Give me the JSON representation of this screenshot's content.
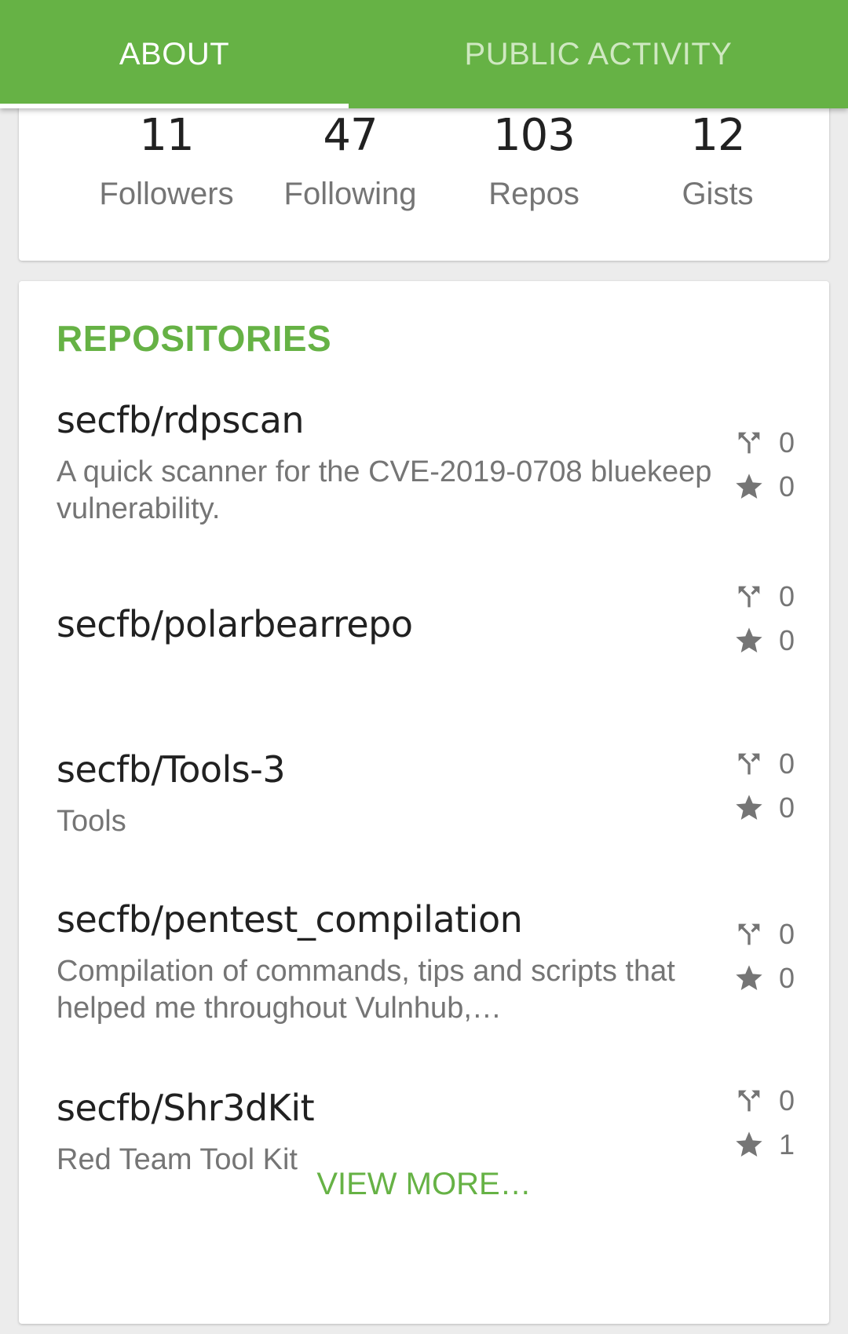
{
  "tabs": {
    "about": "ABOUT",
    "public_activity": "PUBLIC ACTIVITY"
  },
  "stats": [
    {
      "value": "11",
      "label": "Followers"
    },
    {
      "value": "47",
      "label": "Following"
    },
    {
      "value": "103",
      "label": "Repos"
    },
    {
      "value": "12",
      "label": "Gists"
    }
  ],
  "repositories": {
    "title": "REPOSITORIES",
    "items": [
      {
        "name": "secfb/rdpscan",
        "description": "A quick scanner for the CVE-2019-0708 bluekeep vulnerability.",
        "forks": "0",
        "stars": "0"
      },
      {
        "name": "secfb/polarbearrepo",
        "description": "",
        "forks": "0",
        "stars": "0"
      },
      {
        "name": "secfb/Tools-3",
        "description": "Tools",
        "forks": "0",
        "stars": "0"
      },
      {
        "name": "secfb/pentest_compilation",
        "description": "Compilation of commands, tips and scripts that helped me throughout Vulnhub,…",
        "forks": "0",
        "stars": "0"
      },
      {
        "name": "secfb/Shr3dKit",
        "description": "Red Team Tool Kit",
        "forks": "0",
        "stars": "1"
      }
    ],
    "view_more": "VIEW MORE…"
  },
  "icons": {
    "fork": "fork-icon",
    "star": "star-icon"
  },
  "colors": {
    "accent": "#66b245",
    "tab_inactive": "#cfe8c1",
    "muted_text": "#757575"
  }
}
